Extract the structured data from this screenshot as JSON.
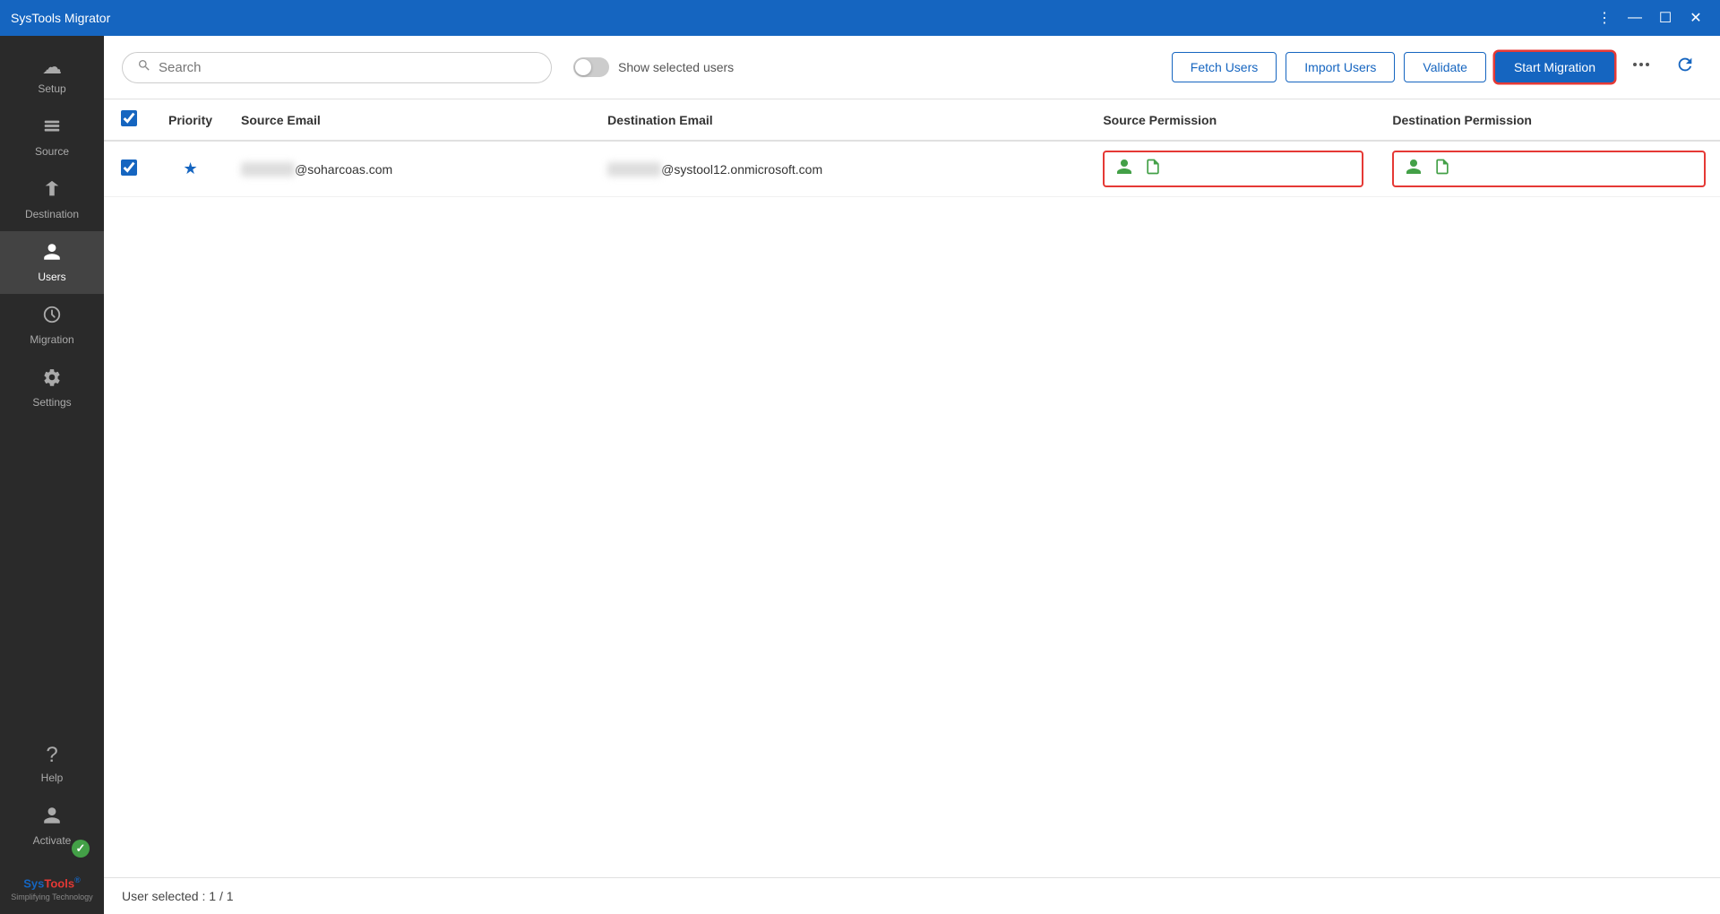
{
  "app": {
    "title": "SysTools Migrator",
    "window_controls": {
      "menu": "⋮",
      "minimize": "—",
      "maximize": "☐",
      "close": "✕"
    }
  },
  "sidebar": {
    "items": [
      {
        "id": "setup",
        "label": "Setup",
        "icon": "☁"
      },
      {
        "id": "source",
        "label": "Source",
        "icon": "📤"
      },
      {
        "id": "destination",
        "label": "Destination",
        "icon": "📥"
      },
      {
        "id": "users",
        "label": "Users",
        "icon": "👤",
        "active": true
      },
      {
        "id": "migration",
        "label": "Migration",
        "icon": "⏱"
      },
      {
        "id": "settings",
        "label": "Settings",
        "icon": "⚙"
      }
    ],
    "bottom": {
      "help_label": "Help",
      "help_icon": "?",
      "activate_label": "Activate",
      "activate_icon": "👤",
      "activate_badge": "✓"
    }
  },
  "toolbar": {
    "search_placeholder": "Search",
    "show_selected_label": "Show selected users",
    "fetch_users_label": "Fetch Users",
    "import_users_label": "Import Users",
    "validate_label": "Validate",
    "start_migration_label": "Start Migration",
    "more_icon": "•••",
    "refresh_icon": "↻"
  },
  "table": {
    "columns": [
      "",
      "Priority",
      "Source Email",
      "Destination Email",
      "Source Permission",
      "Destination Permission"
    ],
    "rows": [
      {
        "checked": true,
        "priority_star": "★",
        "source_email_blur": "██████",
        "source_email_domain": "@soharcoas.com",
        "dest_email_blur": "██████",
        "dest_email_domain": "@systool12.onmicrosoft.com",
        "source_permissions": [
          "person",
          "file"
        ],
        "dest_permissions": [
          "person",
          "file"
        ]
      }
    ]
  },
  "status_bar": {
    "text": "User selected : 1 / 1"
  },
  "colors": {
    "primary": "#1565c0",
    "danger": "#e53935",
    "success": "#43a047",
    "sidebar_bg": "#2a2a2a",
    "active_row_border": "#e53935"
  }
}
